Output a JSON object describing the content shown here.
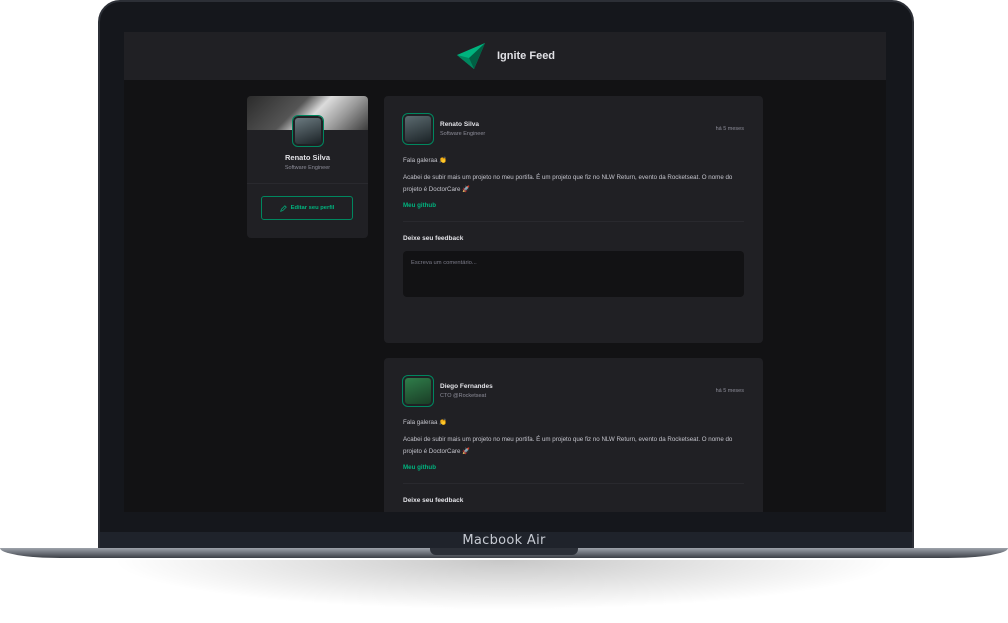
{
  "app": {
    "title": "Ignite Feed"
  },
  "device": {
    "label": "Macbook Air"
  },
  "profile": {
    "name": "Renato Silva",
    "role": "Software Engineer",
    "edit_label": "Editar seu perfil"
  },
  "posts": [
    {
      "author": "Renato Silva",
      "role": "Software Engineer",
      "time": "há 5 meses",
      "greeting": "Fala galeraa 👏",
      "body": "Acabei de subir mais um projeto no meu portifa. É um projeto que fiz no NLW Return, evento da Rocketseat. O nome do projeto é DoctorCare 🚀",
      "link": "Meu github",
      "feedback_title": "Deixe seu feedback",
      "comment_placeholder": "Escreva um comentário..."
    },
    {
      "author": "Diego Fernandes",
      "role": "CTO @Rocketseat",
      "time": "há 5 meses",
      "greeting": "Fala galeraa 👏",
      "body": "Acabei de subir mais um projeto no meu portifa. É um projeto que fiz no NLW Return, evento da Rocketseat. O nome do projeto é DoctorCare 🚀",
      "link": "Meu github",
      "feedback_title": "Deixe seu feedback"
    }
  ],
  "colors": {
    "accent": "#00b37e",
    "accent_dark": "#00875f",
    "background": "#121214",
    "card": "#202024"
  },
  "icons": {
    "logo": "ignite-logo-icon",
    "edit": "pencil-icon"
  }
}
